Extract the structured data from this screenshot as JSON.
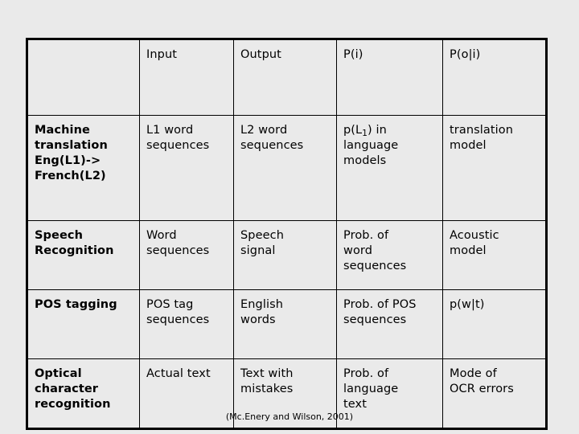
{
  "slide": {
    "background_color": "#eaeaea",
    "citation": "(Mc.Enery and Wilson, 2001)"
  },
  "table": {
    "border_color": "#000000",
    "cell_background": "#eaeaea",
    "columns": [
      {
        "id": "task",
        "header": ""
      },
      {
        "id": "input",
        "header": "Input"
      },
      {
        "id": "output",
        "header": "Output"
      },
      {
        "id": "pi",
        "header": "P(i)"
      },
      {
        "id": "poi",
        "header": "P(o|i)"
      }
    ],
    "rows": [
      {
        "id": "machine-translation",
        "task": "Machine translation Eng(L1)-> French(L2)",
        "task_lines": [
          "Machine",
          "translation",
          "Eng(L1)->",
          "French(L2)"
        ],
        "input": "L1 word sequences",
        "input_lines": [
          "L1 word",
          "sequences"
        ],
        "output": "L2 word sequences",
        "output_lines": [
          "L2 word",
          "sequences"
        ],
        "pi": "p(L1) in language models",
        "pi_lines": [
          "p(L",
          "1",
          ") in",
          "language",
          "models"
        ],
        "poi": "translation model",
        "poi_lines": [
          "translation",
          "model"
        ]
      },
      {
        "id": "speech-recognition",
        "task": "Speech Recognition",
        "task_lines": [
          "Speech",
          "Recognition"
        ],
        "input": "Word sequences",
        "input_lines": [
          "Word",
          "sequences"
        ],
        "output": "Speech signal",
        "output_lines": [
          "Speech",
          "signal"
        ],
        "pi": "Prob. of word sequences",
        "pi_lines": [
          "Prob. of",
          "word",
          "sequences"
        ],
        "poi": "Acoustic model",
        "poi_lines": [
          "Acoustic",
          "model"
        ]
      },
      {
        "id": "pos-tagging",
        "task": "POS tagging",
        "task_lines": [
          "POS tagging"
        ],
        "input": "POS tag sequences",
        "input_lines": [
          "POS tag",
          "sequences"
        ],
        "output": "English words",
        "output_lines": [
          "English",
          "words"
        ],
        "pi": "Prob. of POS sequences",
        "pi_lines": [
          "Prob. of POS",
          "sequences"
        ],
        "poi": "p(w|t)",
        "poi_lines": [
          "p(w|t)"
        ]
      },
      {
        "id": "optical-character-recognition",
        "task": "Optical character recognition",
        "task_lines": [
          "Optical",
          "character",
          "recognition"
        ],
        "input": "Actual text",
        "input_lines": [
          "Actual text"
        ],
        "output": "Text with mistakes",
        "output_lines": [
          "Text with",
          "mistakes"
        ],
        "pi": "Prob. of language text",
        "pi_lines": [
          "Prob. of",
          "language",
          "text"
        ],
        "poi": "Mode of OCR errors",
        "poi_lines": [
          "Mode of",
          "OCR errors"
        ]
      }
    ]
  }
}
